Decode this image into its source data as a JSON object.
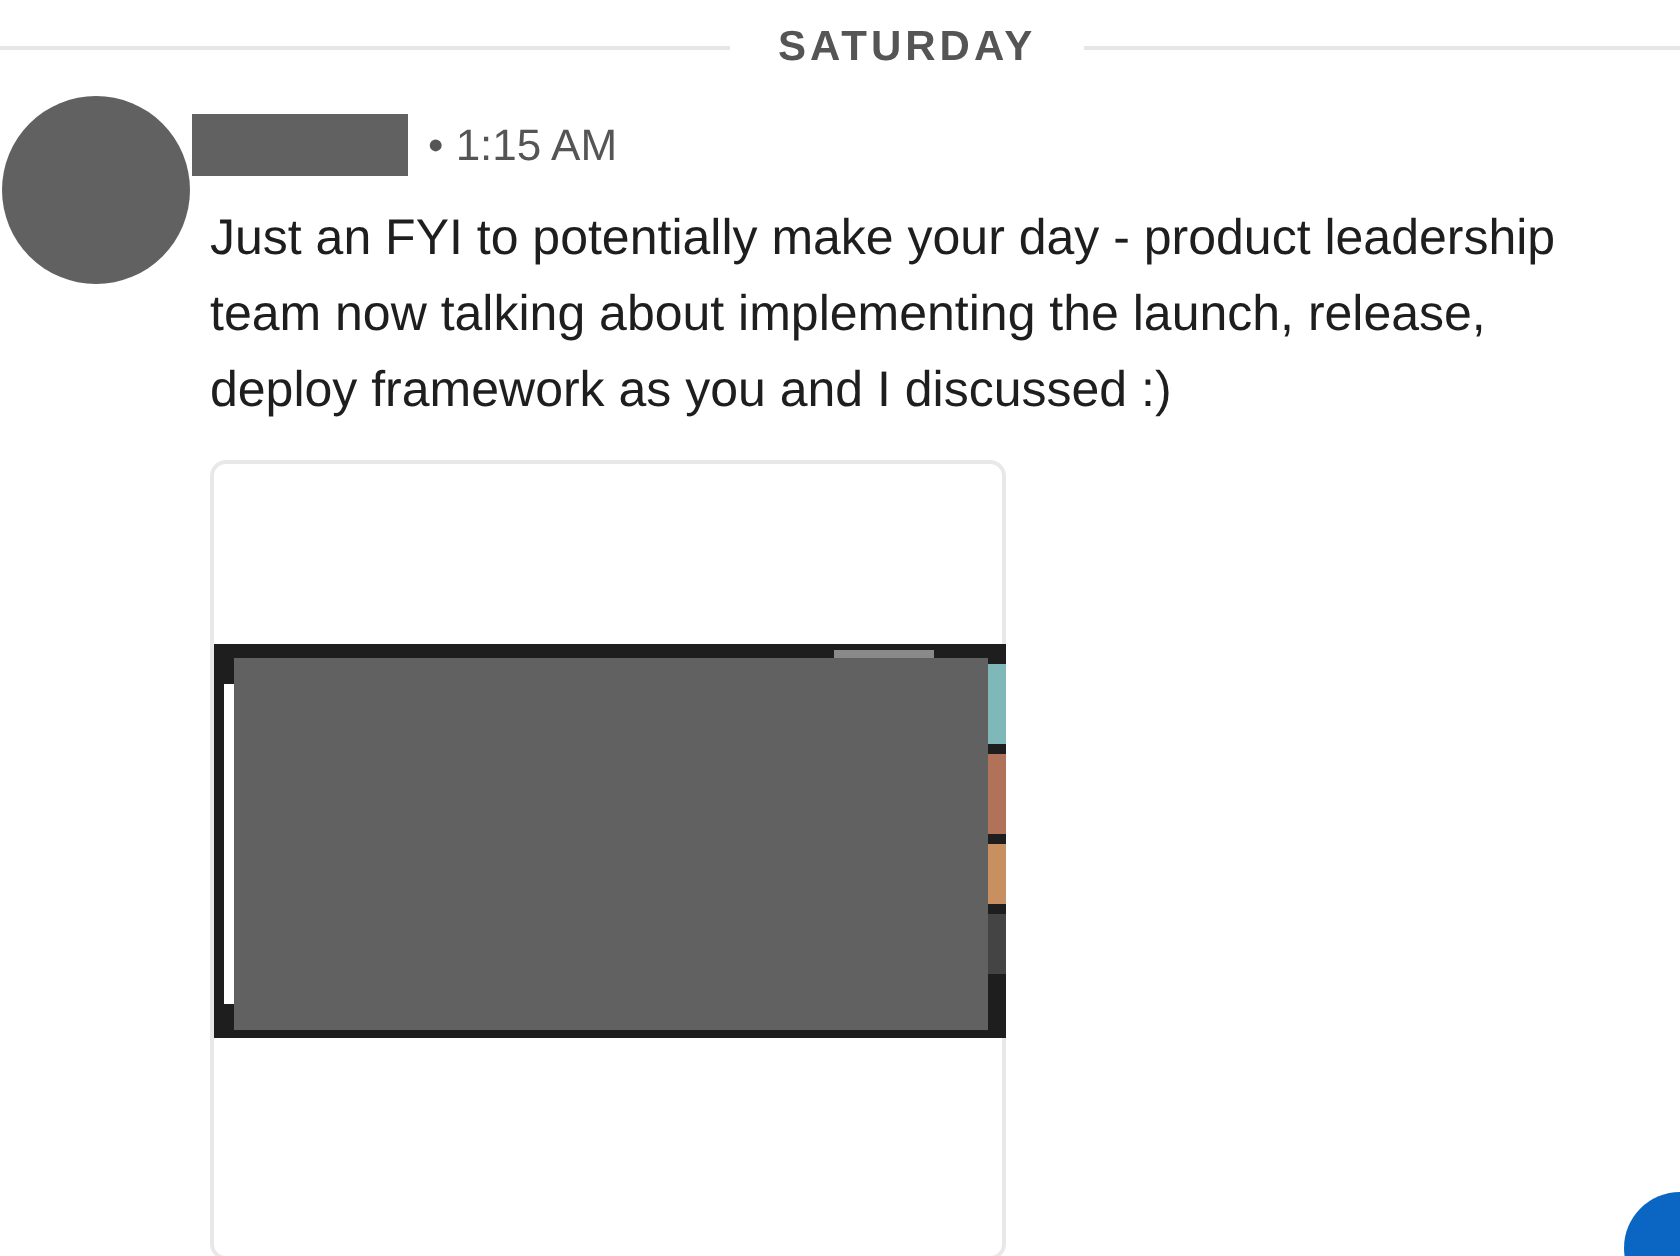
{
  "date_divider": "SATURDAY",
  "message": {
    "time": "• 1:15 AM",
    "text": "Just an FYI to potentially make your day - product leadership team now talking about implementing the launch, release, deploy framework as you and I discussed :)"
  }
}
